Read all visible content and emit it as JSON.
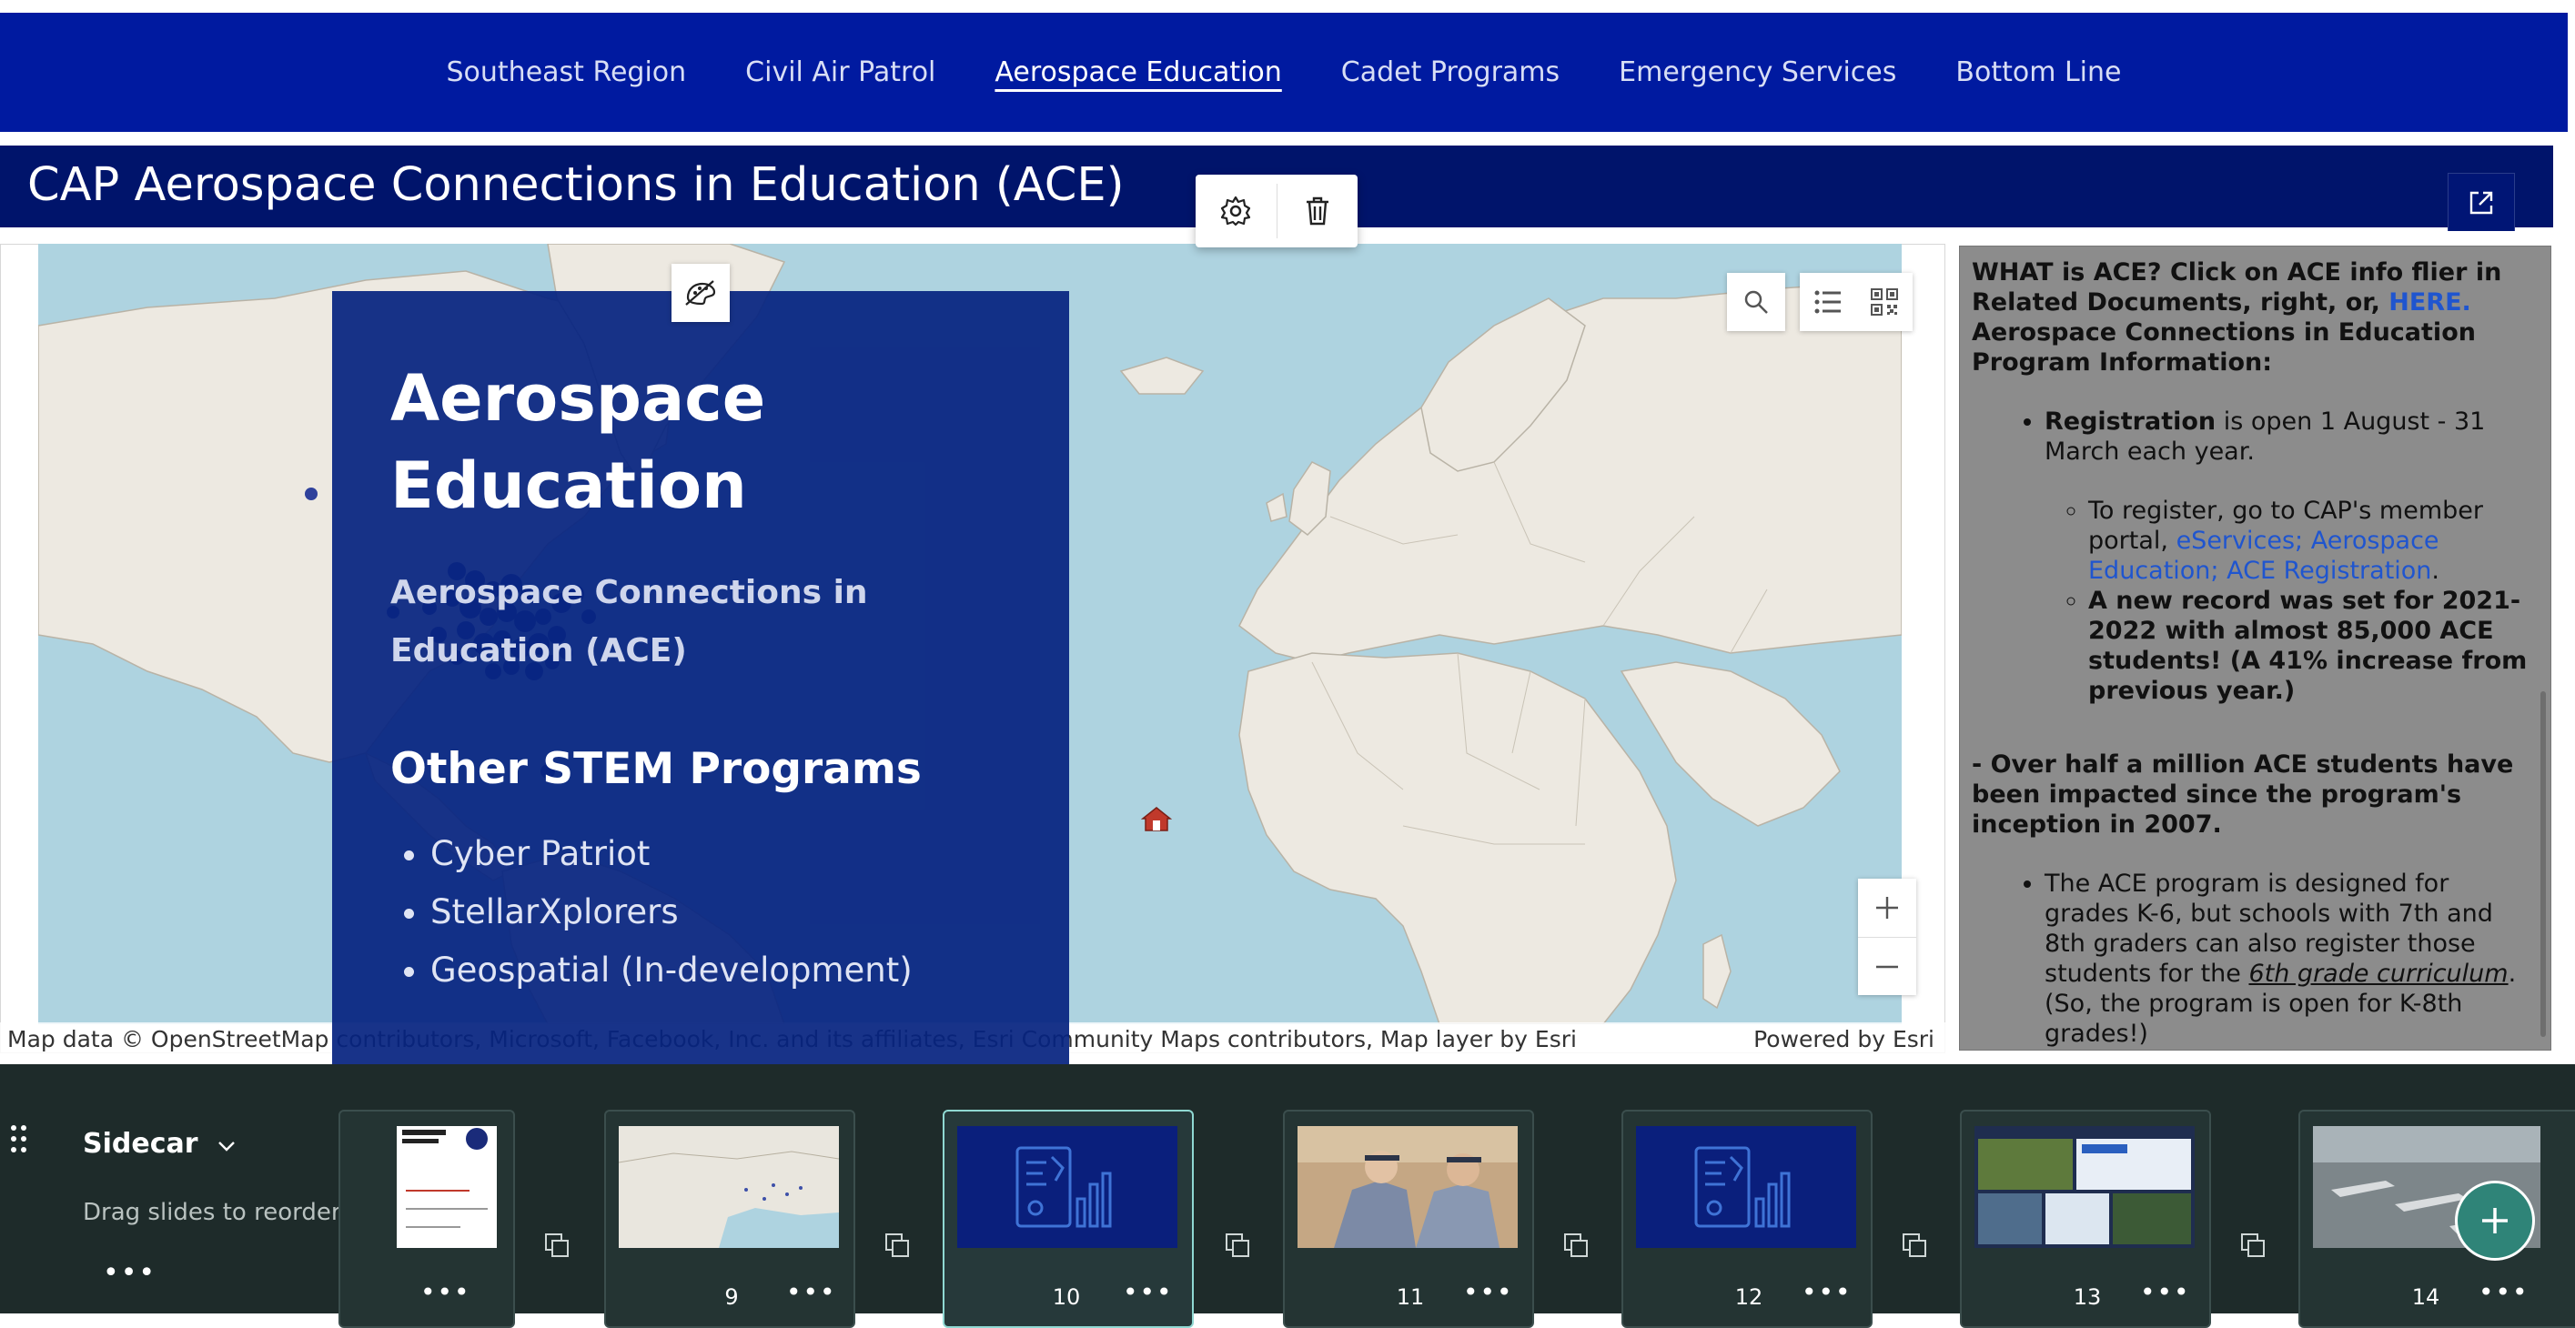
{
  "nav": {
    "items": [
      "Southeast Region",
      "Civil Air Patrol",
      "Aerospace Education",
      "Cadet Programs",
      "Emergency Services",
      "Bottom Line"
    ],
    "active": "Aerospace Education"
  },
  "header": {
    "title": "CAP Aerospace Connections in Education (ACE)"
  },
  "map": {
    "attribution": "Map data © OpenStreetMap contributors, Microsoft, Facebook, Inc. and its affiliates, Esri Community Maps contributors, Map layer by Esri",
    "powered_by": "Powered by Esri",
    "icons": [
      "search-icon",
      "legend-icon",
      "qr-code-icon",
      "zoom-in-icon",
      "zoom-out-icon",
      "map-pin-icon",
      "map-style-icon"
    ]
  },
  "panel": {
    "title": "Aerospace Education",
    "subtitle": "Aerospace Connections in Education (ACE)",
    "heading": "Other STEM Programs",
    "programs": [
      "Cyber Patriot",
      "StellarXplorers",
      "Geospatial (In-development)"
    ]
  },
  "sidecar": {
    "intro": "WHAT is ACE? Click on ACE info flier in Related Documents, right, or, ",
    "here_link": "HERE.",
    "program_info": "Aerospace Connections in Education Program Information:",
    "registration_bold": "Registration",
    "registration_rest": " is open 1 August - 31 March each year.",
    "register_text": "To register, go to CAP's member portal, ",
    "register_link": "eServices; Aerospace Education; ACE Registration",
    "register_end": ".",
    "record": "A new record was set for 2021-2022 with almost 85,000 ACE students! (A 41% increase from previous year.)",
    "half_million": "- Over half a million ACE students have been impacted since the program's inception in 2007.",
    "designed_pre": "The ACE program is designed for grades K-6, but schools with 7th and 8th graders can also register those students for the ",
    "designed_italic": "6th grade curriculum",
    "designed_post": ". (So, the program is open for K-8th grades!)"
  },
  "strip": {
    "label": "Sidecar",
    "hint": "Drag slides to reorder",
    "more": "•••",
    "slides": [
      {
        "num": "",
        "thumb": "region-doc"
      },
      {
        "num": "9",
        "thumb": "us-map"
      },
      {
        "num": "10",
        "thumb": "dashboard-blue",
        "active": true
      },
      {
        "num": "11",
        "thumb": "cadets-salute"
      },
      {
        "num": "12",
        "thumb": "dashboard-blue"
      },
      {
        "num": "13",
        "thumb": "dashboard-collage"
      },
      {
        "num": "14",
        "thumb": "aircraft-ramp"
      }
    ]
  },
  "toolbar": {
    "icons": [
      "gear-icon",
      "trash-icon",
      "expand-icon",
      "plus-icon"
    ]
  },
  "colors": {
    "nav_bg": "#001aa0",
    "title_bg": "#00146b",
    "panel_bg": "#062380",
    "map_water": "#aed3e0",
    "map_land": "#ede9e1",
    "link": "#1f55cf",
    "strip_bg": "#1e2b2a",
    "add_button": "#2f8478"
  }
}
